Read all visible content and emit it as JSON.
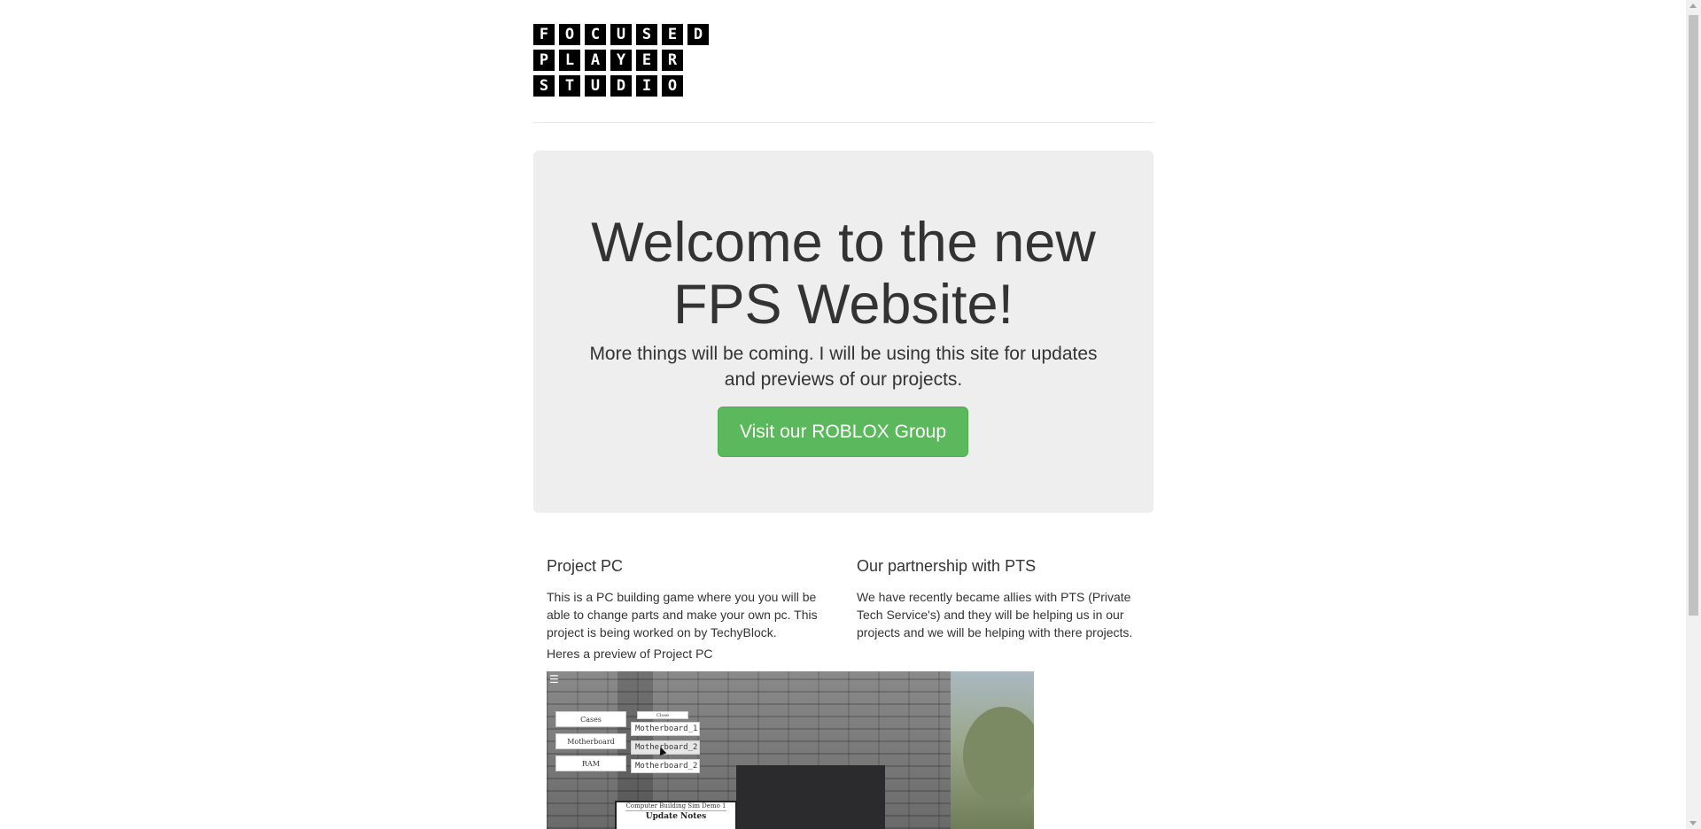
{
  "logo": {
    "rows": [
      [
        "F",
        "O",
        "C",
        "U",
        "S",
        "E",
        "D"
      ],
      [
        "P",
        "L",
        "A",
        "Y",
        "E",
        "R"
      ],
      [
        "S",
        "T",
        "U",
        "D",
        "I",
        "O"
      ]
    ]
  },
  "hero": {
    "title_line1": "Welcome to the new",
    "title_line2": "FPS Website!",
    "lead": "More things will be coming. I will be using this site for updates and previews of our projects.",
    "button_label": "Visit our ROBLOX Group"
  },
  "sections": [
    {
      "heading": "Project PC",
      "body": "This is a PC building game where you you will be able to change parts and make your own pc. This project is being worked on by TechyBlock."
    },
    {
      "heading": "Our partnership with PTS",
      "body": "We have recently became allies with PTS (Private Tech Service's) and they will be helping us in our projects and we will be helping with there projects."
    }
  ],
  "preview": {
    "caption": "Heres a preview of Project PC",
    "menu_buttons": [
      "Cases",
      "Motherboard",
      "RAM"
    ],
    "close_label": "Close",
    "items": [
      "Motherboard_1",
      "Motherboard_2",
      "Motherboard_2"
    ],
    "notes_subtitle": "Computer Building Sim Demo 1",
    "notes_title": "Update Notes"
  },
  "colors": {
    "accent_green": "#5cb85c",
    "jumbotron_bg": "#eeeeee",
    "text": "#333333"
  }
}
